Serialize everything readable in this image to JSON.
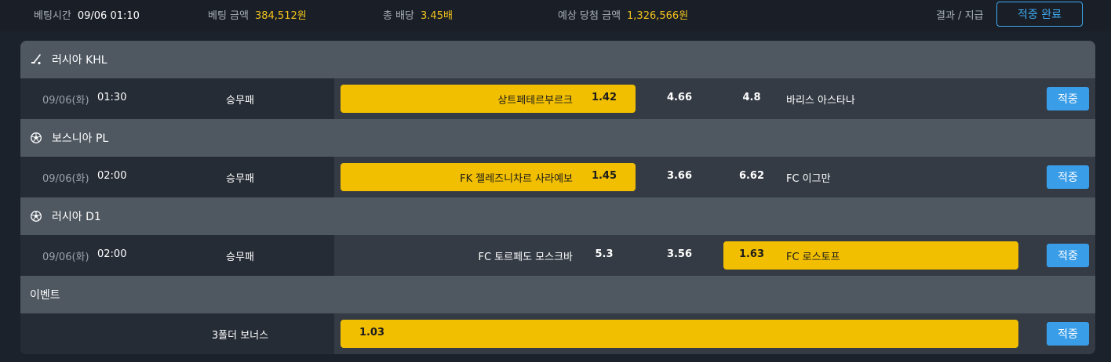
{
  "summary": {
    "bet_time_label": "베팅시간",
    "bet_time_value": "09/06 01:10",
    "bet_amount_label": "베팅 금액",
    "bet_amount_value": "384,512원",
    "total_odds_label": "총 배당",
    "total_odds_value": "3.45배",
    "expected_win_label": "예상 당첨 금액",
    "expected_win_value": "1,326,566원",
    "result_label": "결과 / 지급",
    "status_button": "적중 완료"
  },
  "colors": {
    "accent": "#3a9de8",
    "selected": "#f2bf00",
    "gold_text": "#f2c21b"
  },
  "matches": [
    {
      "league_icon": "hockey-icon",
      "league": "러시아 KHL",
      "date": "09/06(화)",
      "time": "01:30",
      "bet_type": "승무패",
      "home_team": "상트페테르부르크",
      "home_odds": "1.42",
      "draw_odds": "4.66",
      "away_odds": "4.8",
      "away_team": "바리스 아스타나",
      "selected": "home",
      "result": "적중"
    },
    {
      "league_icon": "soccer-ball-icon",
      "league": "보스니아 PL",
      "date": "09/06(화)",
      "time": "02:00",
      "bet_type": "승무패",
      "home_team": "FK 젤레즈니차르 사라예보",
      "home_odds": "1.45",
      "draw_odds": "3.66",
      "away_odds": "6.62",
      "away_team": "FC 이그만",
      "selected": "home",
      "result": "적중"
    },
    {
      "league_icon": "soccer-ball-icon",
      "league": "러시아 D1",
      "date": "09/06(화)",
      "time": "02:00",
      "bet_type": "승무패",
      "home_team": "FC 토르페도 모스크바",
      "home_odds": "5.3",
      "draw_odds": "3.56",
      "away_odds": "1.63",
      "away_team": "FC 로스토프",
      "selected": "away",
      "result": "적중"
    }
  ],
  "event": {
    "header": "이벤트",
    "label": "3폴더 보너스",
    "odds": "1.03",
    "result": "적중"
  }
}
